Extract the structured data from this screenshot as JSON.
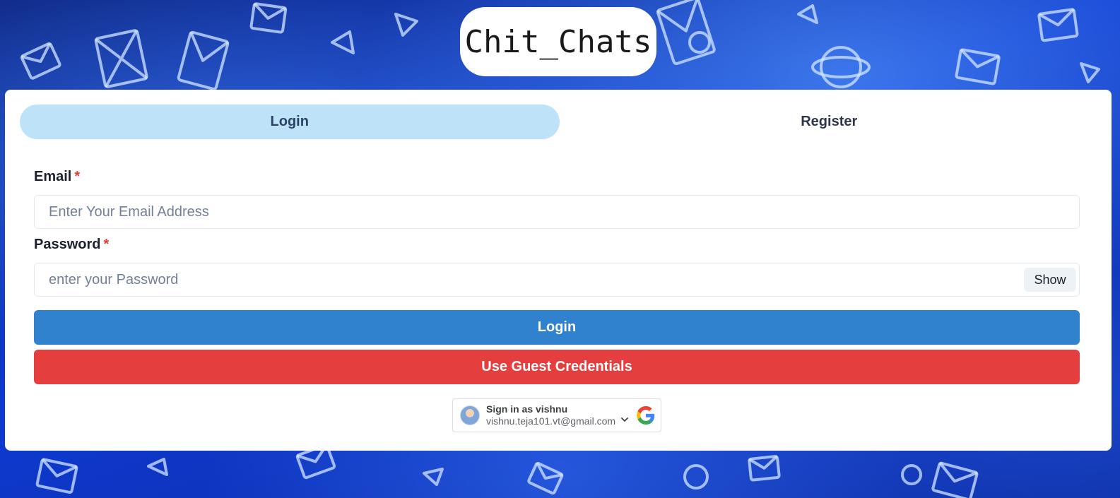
{
  "brand": {
    "title": "Chit_Chats"
  },
  "tabs": [
    {
      "label": "Login",
      "active": true
    },
    {
      "label": "Register",
      "active": false
    }
  ],
  "form": {
    "email": {
      "label": "Email",
      "required_mark": "*",
      "placeholder": "Enter Your Email Address",
      "value": ""
    },
    "password": {
      "label": "Password",
      "required_mark": "*",
      "placeholder": "enter your Password",
      "value": "",
      "toggle_label": "Show"
    },
    "login_button": "Login",
    "guest_button": "Use Guest Credentials"
  },
  "google_signin": {
    "name_line": "Sign in as vishnu",
    "email": "vishnu.teja101.vt@gmail.com",
    "icons": [
      "avatar",
      "chevron-down-icon",
      "google-logo-icon"
    ]
  },
  "colors": {
    "accent_blue": "#3182ce",
    "guest_red": "#e53e3e",
    "active_tab": "#bee3f8",
    "required_red": "#e53e3e"
  }
}
